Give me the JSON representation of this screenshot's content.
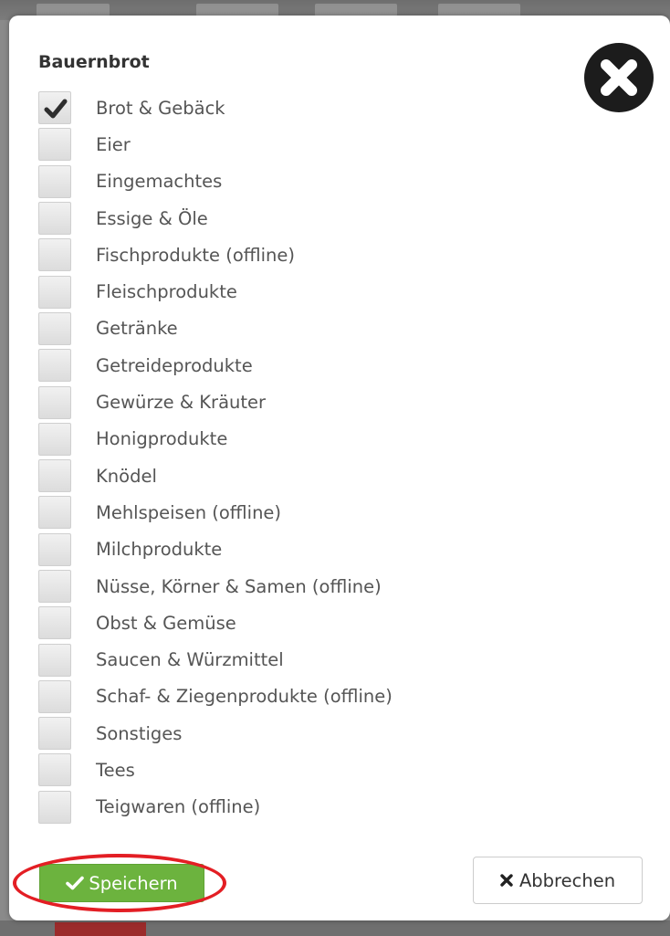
{
  "modal": {
    "title": "Bauernbrot",
    "close_icon": "close-circle-icon"
  },
  "categories": [
    {
      "label": "Brot & Gebäck",
      "checked": true
    },
    {
      "label": "Eier",
      "checked": false
    },
    {
      "label": "Eingemachtes",
      "checked": false
    },
    {
      "label": "Essige & Öle",
      "checked": false
    },
    {
      "label": "Fischprodukte (offline)",
      "checked": false
    },
    {
      "label": "Fleischprodukte",
      "checked": false
    },
    {
      "label": "Getränke",
      "checked": false
    },
    {
      "label": "Getreideprodukte",
      "checked": false
    },
    {
      "label": "Gewürze & Kräuter",
      "checked": false
    },
    {
      "label": "Honigprodukte",
      "checked": false
    },
    {
      "label": "Knödel",
      "checked": false
    },
    {
      "label": "Mehlspeisen (offline)",
      "checked": false
    },
    {
      "label": "Milchprodukte",
      "checked": false
    },
    {
      "label": "Nüsse, Körner & Samen (offline)",
      "checked": false
    },
    {
      "label": "Obst & Gemüse",
      "checked": false
    },
    {
      "label": "Saucen & Würzmittel",
      "checked": false
    },
    {
      "label": "Schaf- & Ziegenprodukte (offline)",
      "checked": false
    },
    {
      "label": "Sonstiges",
      "checked": false
    },
    {
      "label": "Tees",
      "checked": false
    },
    {
      "label": "Teigwaren (offline)",
      "checked": false
    }
  ],
  "buttons": {
    "save_label": "Speichern",
    "save_icon": "check-icon",
    "cancel_label": "Abbrechen",
    "cancel_icon": "x-icon"
  },
  "colors": {
    "save_green": "#6cb33e",
    "highlight_red": "#e31e24",
    "close_dark": "#1c1c1c"
  }
}
